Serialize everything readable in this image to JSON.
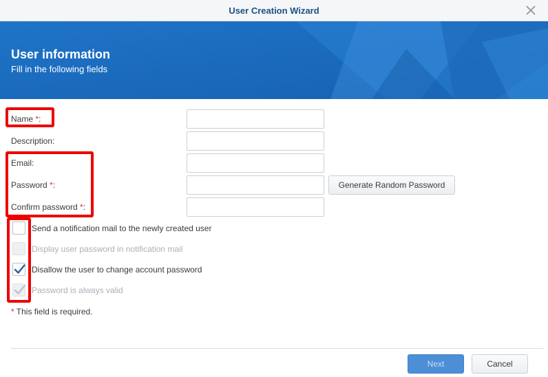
{
  "window": {
    "title": "User Creation Wizard",
    "close_icon": "close-icon"
  },
  "banner": {
    "heading": "User information",
    "subheading": "Fill in the following fields"
  },
  "form": {
    "name": {
      "label": "Name",
      "required_mark": "*",
      "suffix": ":",
      "value": ""
    },
    "description": {
      "label": "Description:",
      "value": ""
    },
    "email": {
      "label": "Email:",
      "value": ""
    },
    "password": {
      "label": "Password",
      "required_mark": "*",
      "suffix": ":",
      "value": ""
    },
    "confirm_password": {
      "label": "Confirm password",
      "required_mark": "*",
      "suffix": ":",
      "value": ""
    },
    "generate_button": "Generate Random Password"
  },
  "options": [
    {
      "label": "Send a notification mail to the newly created user",
      "checked": false,
      "disabled": false
    },
    {
      "label": "Display user password in notification mail",
      "checked": false,
      "disabled": true
    },
    {
      "label": "Disallow the user to change account password",
      "checked": true,
      "disabled": false
    },
    {
      "label": "Password is always valid",
      "checked": true,
      "disabled": true
    }
  ],
  "required_note": {
    "mark": "*",
    "text": " This field is required."
  },
  "footer": {
    "next_label": "Next",
    "cancel_label": "Cancel"
  },
  "colors": {
    "banner": "#1a6cc0",
    "title": "#1d4f80",
    "required": "#d9302c",
    "highlight": "#ee0000",
    "primary_button": "#4d8fd6"
  }
}
